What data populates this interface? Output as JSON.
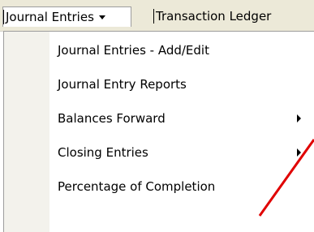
{
  "menubar": {
    "journal_entries": "Journal Entries",
    "transaction_ledger": "Transaction Ledger"
  },
  "dropdown": {
    "items": [
      {
        "label": "Journal Entries - Add/Edit",
        "submenu": false
      },
      {
        "label": "Journal Entry Reports",
        "submenu": false
      },
      {
        "label": "Balances Forward",
        "submenu": true
      },
      {
        "label": "Closing Entries",
        "submenu": true
      },
      {
        "label": "Percentage of Completion",
        "submenu": false
      }
    ]
  },
  "annotation": {
    "color": "#e00000"
  }
}
